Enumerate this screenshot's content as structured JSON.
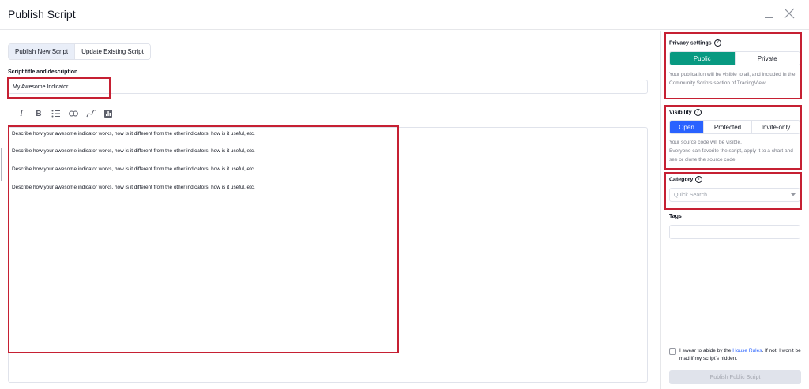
{
  "window": {
    "title": "Publish Script"
  },
  "tabs": [
    {
      "label": "Publish New Script",
      "active": true
    },
    {
      "label": "Update Existing Script",
      "active": false
    }
  ],
  "script": {
    "title_label": "Script title and description",
    "title_value": "My Awesome Indicator"
  },
  "toolbar": {
    "italic": "I",
    "bold": "B",
    "icons": [
      "italic-icon",
      "bold-icon",
      "list-icon",
      "link-icon",
      "chart-line-icon",
      "chart-bars-icon"
    ]
  },
  "editor": {
    "lines": [
      "Describe how your awesome indicator works, how is it different from the other indicators, how is it useful, etc.",
      "Describe how your awesome indicator works, how is it different from the other indicators, how is it useful, etc.",
      "Describe how your awesome indicator works, how is it different from the other indicators, how is it useful, etc.",
      "Describe how your awesome indicator works, how is it different from the other indicators, how is it useful, etc."
    ]
  },
  "privacy": {
    "label": "Privacy settings",
    "info_glyph": "?",
    "options": [
      "Public",
      "Private"
    ],
    "selected": "Public",
    "description": "Your publication will be visible to all, and included in the Community Scripts section of TradingView."
  },
  "visibility": {
    "label": "Visibility",
    "info_glyph": "?",
    "options": [
      "Open",
      "Protected",
      "Invite-only"
    ],
    "selected": "Open",
    "description_line1": "Your source code will be visible.",
    "description_line2": "Everyone can favorite the script, apply it to a chart and see or clone the source code."
  },
  "category": {
    "label": "Category",
    "info_glyph": "i",
    "placeholder": "Quick Search"
  },
  "tags": {
    "label": "Tags",
    "value": ""
  },
  "agreement": {
    "text_before": "I swear to abide by the ",
    "link": "House Rules",
    "text_after": ". If not, I won't be mad if my script's hidden."
  },
  "publish_button": {
    "label": "Publish Public Script"
  },
  "colors": {
    "accent_green": "#089981",
    "accent_blue": "#2962ff",
    "highlight_red": "#c62033"
  }
}
